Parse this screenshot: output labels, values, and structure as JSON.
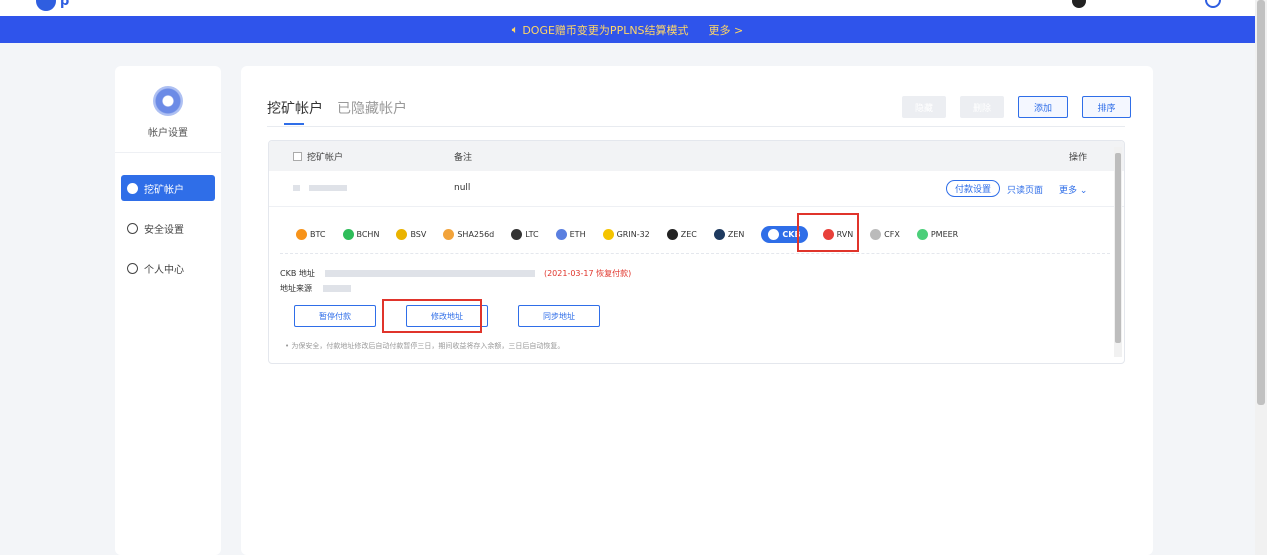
{
  "topbar": {
    "logo_text": "p"
  },
  "notice": {
    "text": "DOGE赠币变更为PPLNS结算模式",
    "more": "更多 >"
  },
  "sidebar": {
    "title": "帐户设置",
    "items": [
      {
        "label": "挖矿帐户",
        "active": true
      },
      {
        "label": "安全设置",
        "active": false
      },
      {
        "label": "个人中心",
        "active": false
      }
    ]
  },
  "tabs": [
    {
      "label": "挖矿帐户",
      "active": true
    },
    {
      "label": "已隐藏帐户",
      "active": false
    }
  ],
  "toolbar": {
    "hide_label": "隐藏",
    "delete_label": "删除",
    "add_label": "添加",
    "sort_label": "排序"
  },
  "table": {
    "col_account": "挖矿帐户",
    "col_note": "备注",
    "col_ops": "操作",
    "row": {
      "note": "null",
      "pay_settings": "付款设置",
      "readonly_page": "只读页面",
      "more": "更多"
    }
  },
  "coins": [
    {
      "label": "BTC",
      "icon": "btc-icon",
      "color": "#f7931a"
    },
    {
      "label": "BCHN",
      "icon": "bchn-icon",
      "color": "#2fbd5a"
    },
    {
      "label": "BSV",
      "icon": "bsv-icon",
      "color": "#eab300"
    },
    {
      "label": "SHA256d",
      "icon": "sha256d-icon",
      "color": "#f2a33a"
    },
    {
      "label": "LTC",
      "icon": "ltc-icon",
      "color": "#333333"
    },
    {
      "label": "ETH",
      "icon": "eth-icon",
      "color": "#5a7fe0"
    },
    {
      "label": "GRIN-32",
      "icon": "grin-icon",
      "color": "#f5c400"
    },
    {
      "label": "ZEC",
      "icon": "zec-icon",
      "color": "#222222"
    },
    {
      "label": "ZEN",
      "icon": "zen-icon",
      "color": "#1e3a5f"
    },
    {
      "label": "CKB",
      "icon": "ckb-icon",
      "color": "#ffffff",
      "active": true
    },
    {
      "label": "RVN",
      "icon": "rvn-icon",
      "color": "#e8403a"
    },
    {
      "label": "CFX",
      "icon": "cfx-icon",
      "color": "#bbbbbb"
    },
    {
      "label": "PMEER",
      "icon": "pmeer-icon",
      "color": "#4ccf7a"
    }
  ],
  "address": {
    "address_label": "CKB 地址",
    "resume_note": "(2021-03-17 恢复付款)",
    "source_label": "地址来源"
  },
  "actions": {
    "pause": "暂停付款",
    "modify": "修改地址",
    "sync": "同步地址"
  },
  "tip": "为保安全，付款地址修改后自动付款暂停三日，期间收益将存入余额，三日后自动恢复。",
  "colors": {
    "accent": "#2f6ee8",
    "notice_bg": "#2f54eb",
    "highlight": "#e0342b"
  }
}
